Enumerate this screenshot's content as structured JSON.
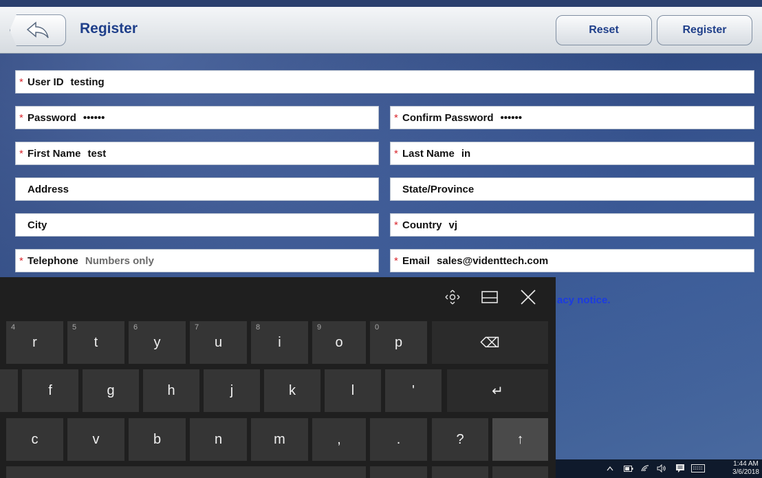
{
  "header": {
    "title": "Register",
    "reset_label": "Reset",
    "register_label": "Register"
  },
  "form": {
    "required_mark": "*",
    "user_id": {
      "label": "User ID",
      "value": "testing"
    },
    "password": {
      "label": "Password",
      "value": "••••••"
    },
    "confirm_password": {
      "label": "Confirm Password",
      "value": "••••••"
    },
    "first_name": {
      "label": "First Name",
      "value": "test"
    },
    "last_name": {
      "label": "Last Name",
      "value": "in"
    },
    "address": {
      "label": "Address"
    },
    "state": {
      "label": "State/Province"
    },
    "city": {
      "label": "City"
    },
    "country": {
      "label": "Country",
      "value": "vj"
    },
    "telephone": {
      "label": "Telephone",
      "placeholder": "Numbers only"
    },
    "email": {
      "label": "Email",
      "value": "sales@videnttech.com"
    },
    "privacy_notice_fragment": "acy notice."
  },
  "keyboard": {
    "row1": [
      {
        "num": "4",
        "key": "r"
      },
      {
        "num": "5",
        "key": "t"
      },
      {
        "num": "6",
        "key": "y"
      },
      {
        "num": "7",
        "key": "u"
      },
      {
        "num": "8",
        "key": "i"
      },
      {
        "num": "9",
        "key": "o"
      },
      {
        "num": "0",
        "key": "p"
      }
    ],
    "backspace": "⌫",
    "row2": [
      "f",
      "g",
      "h",
      "j",
      "k",
      "l",
      "'"
    ],
    "enter": "↵",
    "row3": [
      "c",
      "v",
      "b",
      "n",
      "m",
      ",",
      ".",
      "?"
    ],
    "shift": "↑",
    "icons": {
      "move": "move-icon",
      "dock": "dock-icon",
      "close": "close-icon"
    }
  },
  "taskbar": {
    "time": "1:44 AM",
    "date": "3/6/2018"
  },
  "colors": {
    "accent": "#1f3f8a",
    "required": "#d9272e",
    "link": "#1c3be0"
  }
}
